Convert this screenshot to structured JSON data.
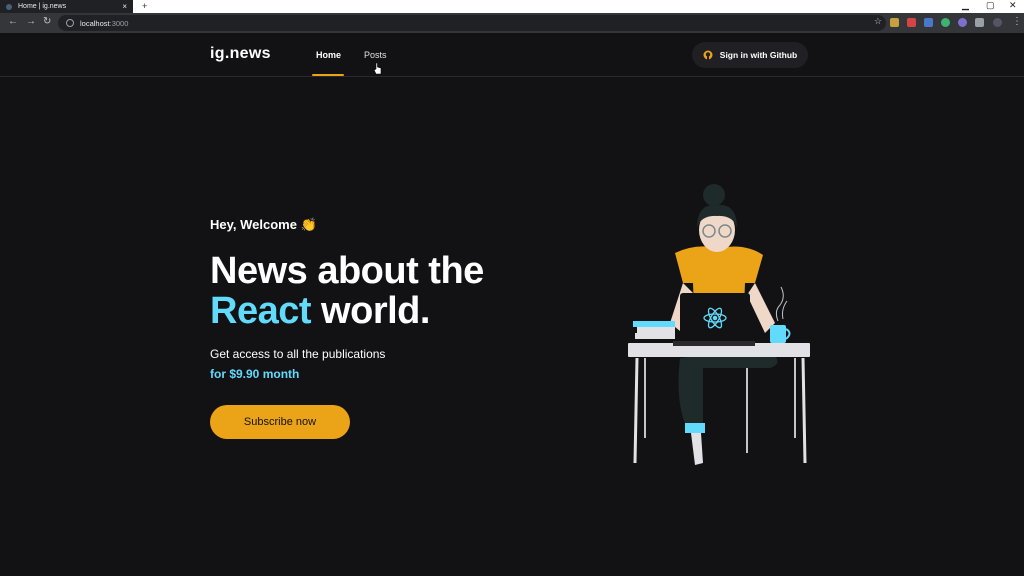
{
  "browser": {
    "tab_title": "Home | ig.news",
    "tab_close": "×",
    "new_tab": "+",
    "url_host": "localhost",
    "url_port": ":3000"
  },
  "header": {
    "logo": "ig.news",
    "nav": [
      {
        "label": "Home",
        "active": true
      },
      {
        "label": "Posts",
        "active": false
      }
    ],
    "github_button": "Sign in with Github"
  },
  "hero": {
    "welcome": "Hey, Welcome 👏",
    "headline_line1": "News about the",
    "headline_highlight": "React",
    "headline_rest": " world.",
    "subtitle": "Get access to all the publications",
    "price": "for $9.90 month",
    "cta": "Subscribe now"
  },
  "colors": {
    "background": "#121214",
    "accent_yellow": "#eba417",
    "accent_cyan": "#61dafb"
  }
}
